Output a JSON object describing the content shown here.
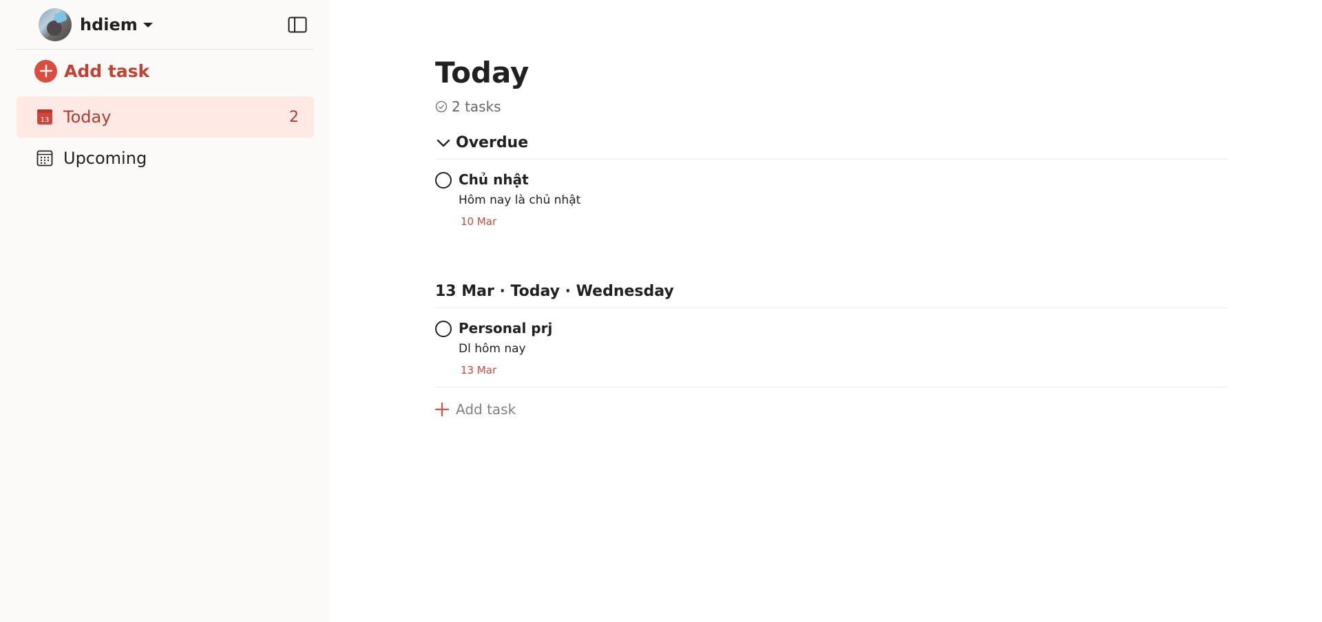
{
  "sidebar": {
    "user": {
      "name": "hdiem"
    },
    "add_task_label": "Add task",
    "items": [
      {
        "label": "Today",
        "count": "2",
        "icon": "calendar-today-icon",
        "active": true
      },
      {
        "label": "Upcoming",
        "icon": "calendar-grid-icon",
        "active": false
      }
    ]
  },
  "main": {
    "title": "Today",
    "task_count": "2 tasks",
    "sections": [
      {
        "header": "Overdue",
        "tasks": [
          {
            "title": "Chủ nhật",
            "description": "Hôm nay là chủ nhật",
            "date": "10 Mar"
          }
        ]
      },
      {
        "header": "13 Mar · Today · Wednesday",
        "tasks": [
          {
            "title": "Personal prj",
            "description": "Dl hôm nay",
            "date": "13 Mar"
          }
        ]
      }
    ],
    "add_task_label": "Add task"
  },
  "colors": {
    "accent": "#dc4c3e",
    "active_bg": "#ffe9e4",
    "date_red": "#d1453b",
    "sidebar_bg": "#fcfaf8"
  }
}
